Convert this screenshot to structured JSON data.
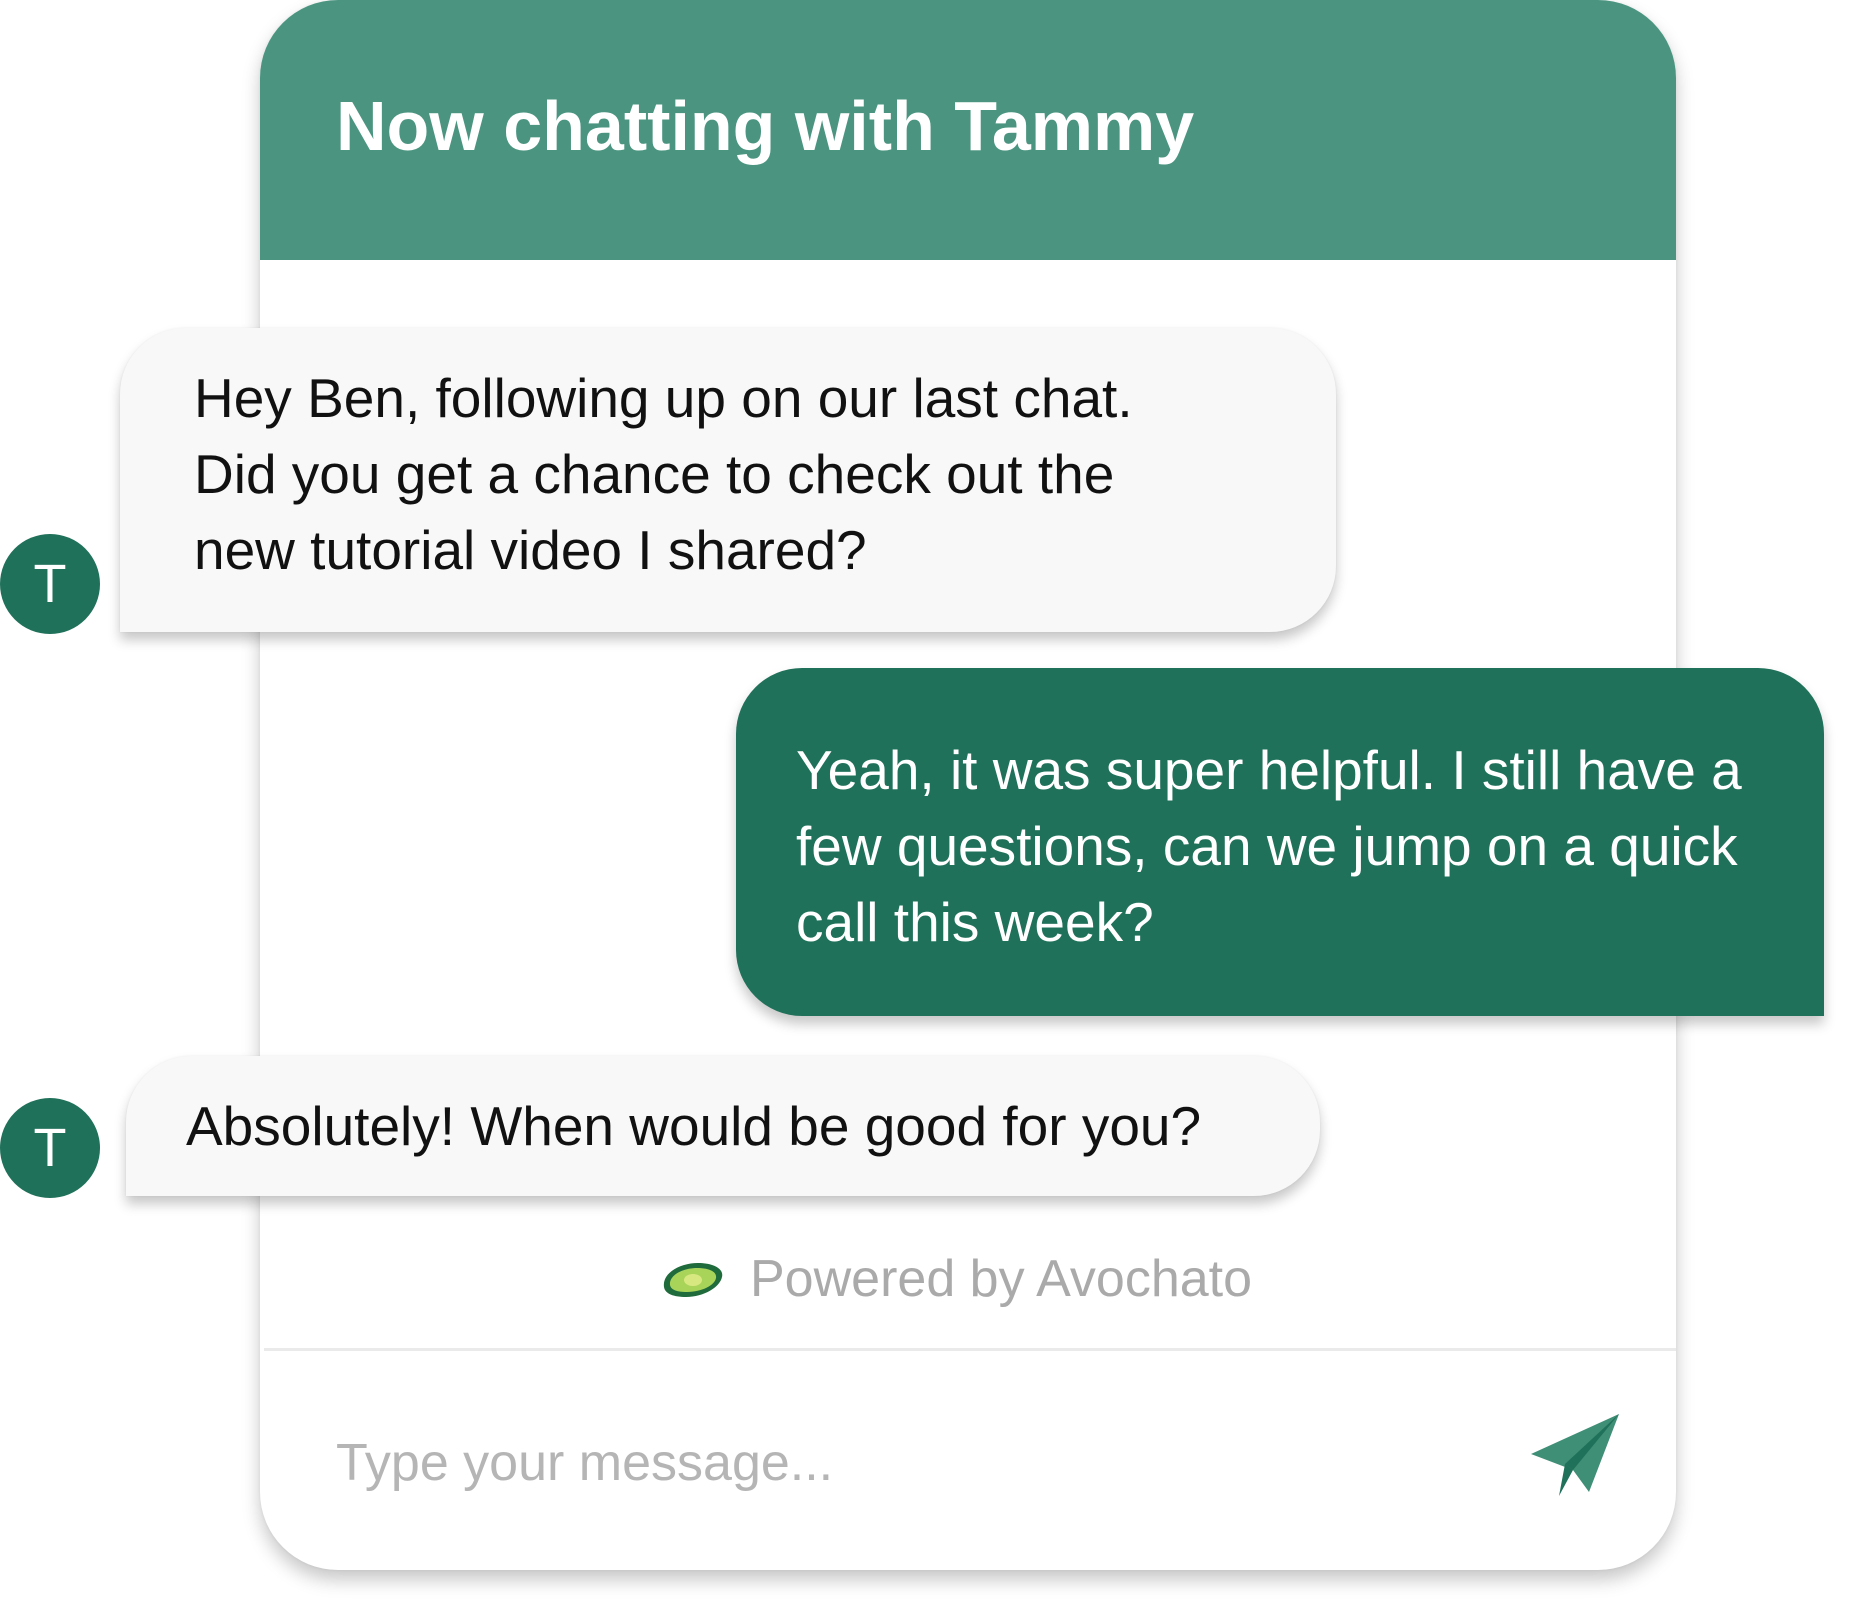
{
  "header": {
    "title": "Now chatting with Tammy"
  },
  "messages": [
    {
      "direction": "incoming",
      "avatar_initial": "T",
      "lines": [
        "Hey Ben, following up on our last chat.",
        "Did you get a chance to check out the",
        "new tutorial video I shared?"
      ]
    },
    {
      "direction": "outgoing",
      "lines": [
        "Yeah, it was super helpful. I still have a",
        "few questions, can we jump on a quick",
        "call this week?"
      ]
    },
    {
      "direction": "incoming",
      "avatar_initial": "T",
      "lines": [
        "Absolutely! When would be good for you?"
      ]
    }
  ],
  "footer": {
    "powered_by": "Powered by Avochato",
    "logo_icon": "avocado-icon"
  },
  "composer": {
    "placeholder": "Type your message...",
    "value": "",
    "send_icon": "paper-plane-icon"
  },
  "colors": {
    "header_bg": "#4b9580",
    "brand_dark": "#20715a",
    "incoming_bubble_bg": "#f8f8f8",
    "muted_text": "#aaaaaa"
  }
}
